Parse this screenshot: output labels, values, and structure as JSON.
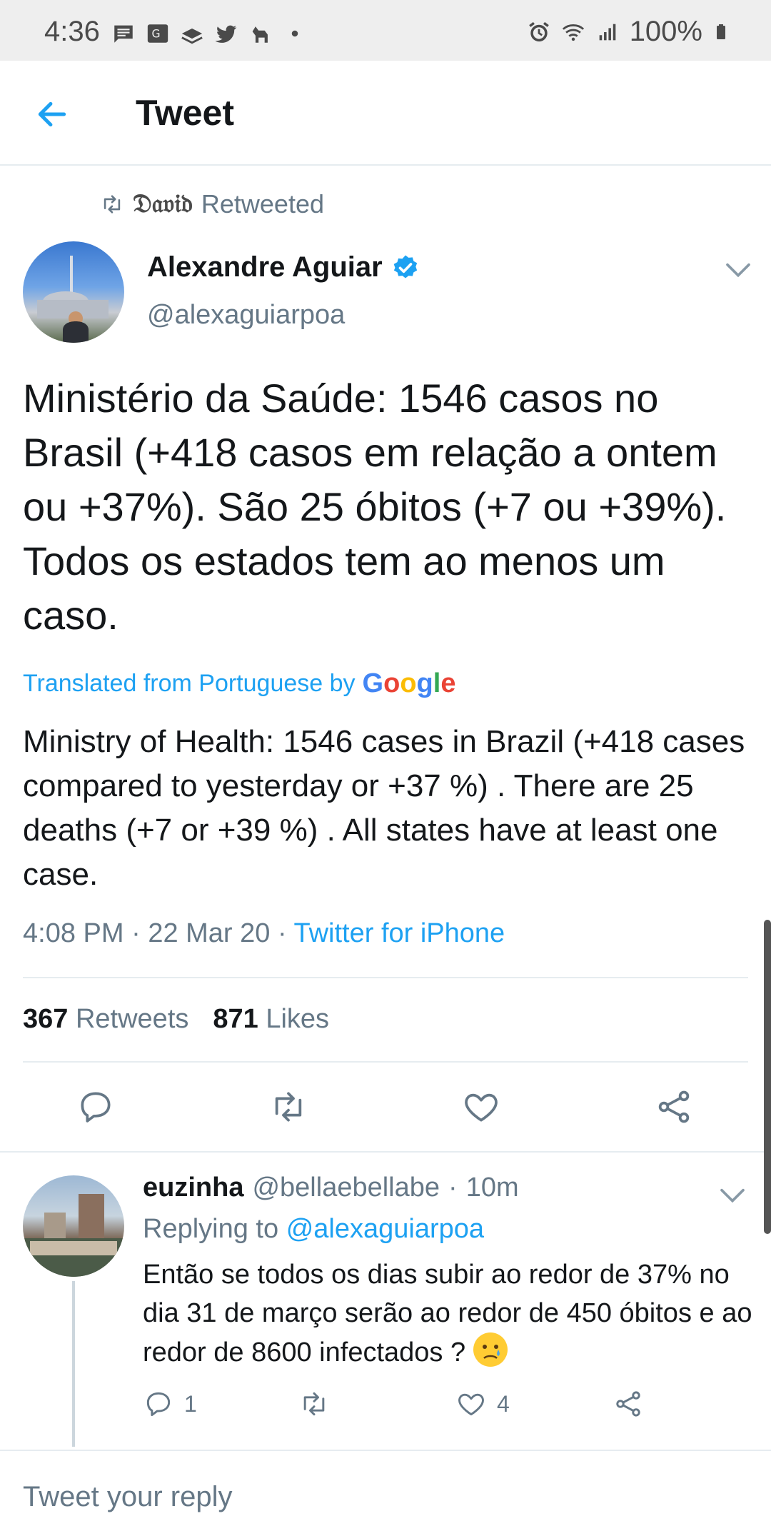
{
  "status_bar": {
    "time": "4:36",
    "battery": "100%",
    "left_icons": [
      "message-icon",
      "translate-icon",
      "signal-stack-icon",
      "twitter-bird-icon",
      "dog-icon",
      "dot-icon"
    ],
    "right_icons": [
      "alarm-icon",
      "wifi-icon",
      "cell-signal-icon",
      "battery-icon"
    ]
  },
  "header": {
    "title": "Tweet",
    "back_icon": "back-arrow-icon"
  },
  "retweet_context": {
    "name": "𝔇𝔞𝔳𝔦𝔡",
    "label": "Retweeted"
  },
  "tweet": {
    "author_name": "Alexandre Aguiar",
    "handle": "@alexaguiarpoa",
    "verified": true,
    "text": "Ministério da Saúde: 1546 casos no Brasil (+418 casos em relação a ontem ou +37%). São 25 óbitos (+7 ou +39%). Todos os estados tem ao menos um caso.",
    "translated_label": "Translated from Portuguese by",
    "translation": "Ministry of Health: 1546 cases in Brazil (+418 cases compared to yesterday or +37 %) . There are 25 deaths (+7 or +39 %) . All states have at least one case.",
    "time": "4:08 PM",
    "date": "22 Mar 20",
    "source": "Twitter for iPhone",
    "retweets_count": "367",
    "retweets_label": "Retweets",
    "likes_count": "871",
    "likes_label": "Likes"
  },
  "google_brand": {
    "g1": "G",
    "o1": "o",
    "o2": "o",
    "g2": "g",
    "l": "l",
    "e": "e"
  },
  "reply": {
    "author_name": "euzinha",
    "handle": "@bellaebellabe",
    "time": "10m",
    "replying_label": "Replying to",
    "replying_handle": "@alexaguiarpoa",
    "text": "Então se todos os dias subir ao redor de 37% no dia 31 de março serão ao redor de 450 óbitos e ao redor de 8600 infectados ?",
    "reply_count": "1",
    "like_count": "4"
  },
  "compose": {
    "placeholder": "Tweet your reply"
  },
  "colors": {
    "twitter_blue": "#1da1f2",
    "secondary_text": "#657786",
    "primary_text": "#14171a",
    "divider": "#e6ecf0"
  }
}
